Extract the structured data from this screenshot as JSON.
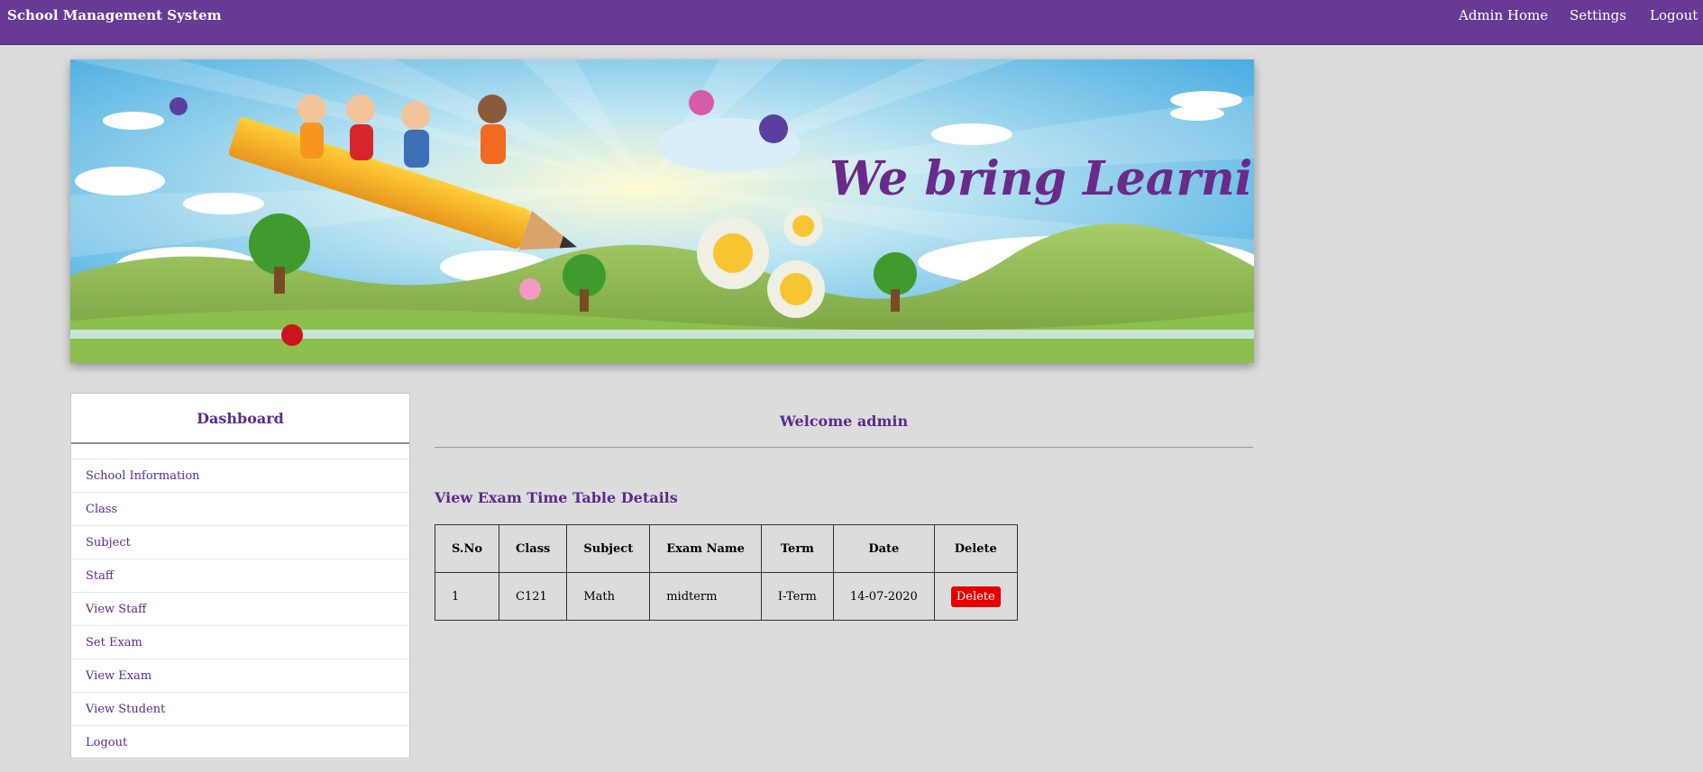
{
  "header": {
    "brand": "School Management System",
    "nav": {
      "admin_home": "Admin Home",
      "settings": "Settings",
      "logout": "Logout"
    }
  },
  "banner": {
    "tagline": "We bring Learning to Life"
  },
  "sidebar": {
    "title": "Dashboard",
    "items": [
      {
        "label": "School Information"
      },
      {
        "label": "Class"
      },
      {
        "label": "Subject"
      },
      {
        "label": "Staff"
      },
      {
        "label": "View Staff"
      },
      {
        "label": "Set Exam"
      },
      {
        "label": "View Exam"
      },
      {
        "label": "View Student"
      },
      {
        "label": "Logout"
      }
    ]
  },
  "main": {
    "welcome": "Welcome admin",
    "section_title": "View Exam Time Table Details",
    "table": {
      "headers": [
        "S.No",
        "Class",
        "Subject",
        "Exam Name",
        "Term",
        "Date",
        "Delete"
      ],
      "rows": [
        {
          "sno": "1",
          "class": "C121",
          "subject": "Math",
          "exam_name": "midterm",
          "term": "I-Term",
          "date": "14-07-2020",
          "delete_label": "Delete"
        }
      ]
    }
  },
  "colors": {
    "topbar": "#673a96",
    "accent_text": "#5b2b8c",
    "delete_button": "#e60000",
    "page_background": "#dcdcdc"
  }
}
